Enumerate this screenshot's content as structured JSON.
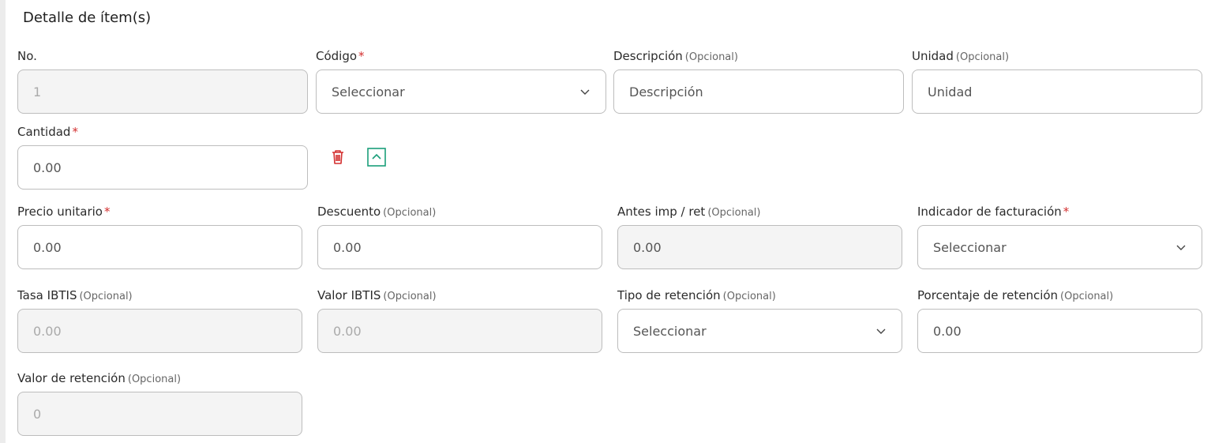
{
  "title": "Detalle de ítem(s)",
  "required_mark": "*",
  "optional_label": "(Opcional)",
  "fields": {
    "no": {
      "label": "No.",
      "value": "1"
    },
    "codigo": {
      "label": "Código",
      "value": "Seleccionar"
    },
    "descripcion": {
      "label": "Descripción",
      "placeholder": "Descripción"
    },
    "unidad": {
      "label": "Unidad",
      "placeholder": "Unidad"
    },
    "cantidad": {
      "label": "Cantidad",
      "placeholder": "0.00"
    },
    "precio": {
      "label": "Precio unitario",
      "placeholder": "0.00"
    },
    "descuento": {
      "label": "Descuento",
      "placeholder": "0.00"
    },
    "antes": {
      "label": "Antes imp / ret",
      "value": "0.00"
    },
    "indicador": {
      "label": "Indicador de facturación",
      "value": "Seleccionar"
    },
    "tasa": {
      "label": "Tasa IBTIS",
      "value": "0.00"
    },
    "valor_ibtis": {
      "label": "Valor IBTIS",
      "value": "0.00"
    },
    "tipo_ret": {
      "label": "Tipo de retención",
      "value": "Seleccionar"
    },
    "porc_ret": {
      "label": "Porcentaje de retención",
      "placeholder": "0.00"
    },
    "valor_ret": {
      "label": "Valor de retención",
      "value": "0"
    }
  },
  "icons": {
    "delete": "trash-icon",
    "collapse": "chevron-up-icon"
  },
  "colors": {
    "required": "#d32f2f",
    "delete": "#d32f2f",
    "collapse": "#1a9e7a",
    "disabled_bg": "#f4f4f4",
    "border": "#bdbdbd"
  }
}
